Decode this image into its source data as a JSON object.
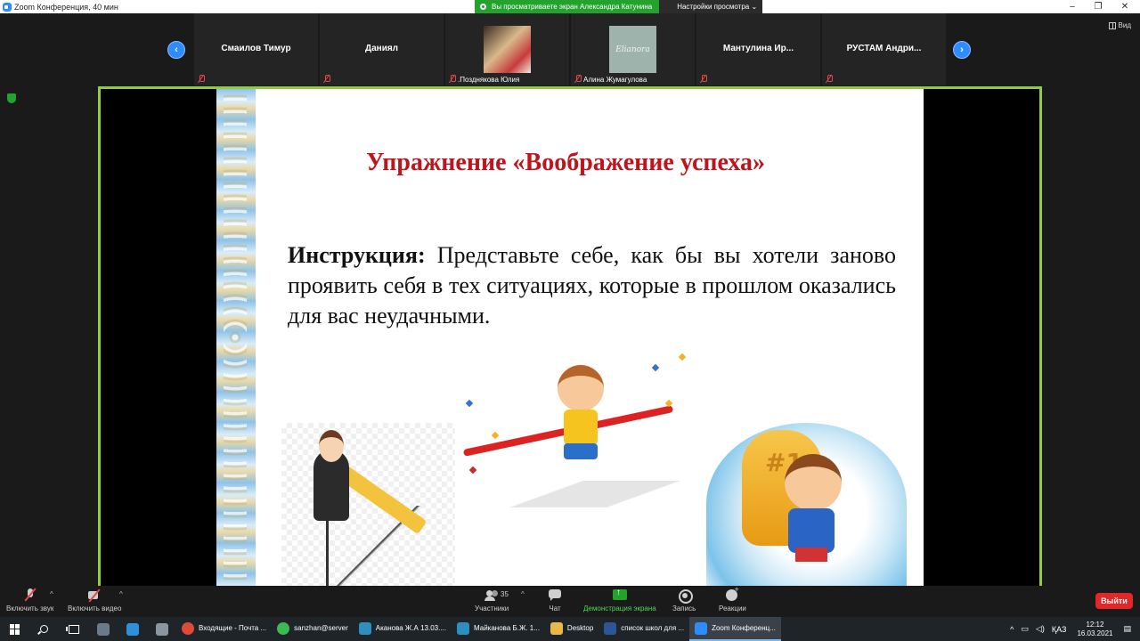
{
  "window": {
    "title": "Zoom Конференция, 40 мин",
    "minimize": "–",
    "restore": "❐",
    "close": "✕"
  },
  "share_banner": {
    "status": "Вы просматриваете экран Александра Катунина",
    "options": "Настройки просмотра ⌄"
  },
  "view_button": {
    "label": "Вид"
  },
  "participants": [
    {
      "name": "Смаилов Тимур",
      "muted": true
    },
    {
      "name": "Даниял",
      "muted": true
    },
    {
      "name": ".Позднякова Юлия",
      "muted": true,
      "has_photo": true
    },
    {
      "name": "Алина Жумагулова",
      "muted": true,
      "has_photo": true,
      "photo_text": "Elianora"
    },
    {
      "name": "Мантулина  Ир...",
      "muted": true
    },
    {
      "name": "РУСТАМ  Андри...",
      "muted": true
    }
  ],
  "nav": {
    "prev": "‹",
    "next": "›"
  },
  "slide": {
    "title": "Упражнение «Воображение успеха»",
    "instruction_label": "Инструкция:",
    "instruction_text": " Представьте себе, как бы вы хотели заново проявить себя в тех ситуациях, которые в прошлом оказались для вас неудачными.",
    "trophy_text": "#1"
  },
  "toolbar": {
    "audio": "Включить звук",
    "video": "Включить видео",
    "participants": "Участники",
    "participants_count": "35",
    "chat": "Чат",
    "share": "Демонстрация экрана",
    "record": "Запись",
    "reactions": "Реакции",
    "leave": "Выйти",
    "caret": "^"
  },
  "taskbar": {
    "apps": [
      {
        "label": "Входящие - Почта ...",
        "color": "#dd4b39"
      },
      {
        "label": "sanzhan@server",
        "color": "#3cba54"
      },
      {
        "label": "Аканова Ж.А 13.03....",
        "color": "#2b8fbf"
      },
      {
        "label": "Майканова Б.Ж. 1...",
        "color": "#2b8fbf"
      },
      {
        "label": "Desktop",
        "color": "#e8b84a"
      },
      {
        "label": "список школ для ...",
        "color": "#2b5797"
      },
      {
        "label": "Zoom Конференц...",
        "color": "#2d8cff"
      }
    ],
    "tray": {
      "up": "^",
      "lang": "ҚАЗ",
      "time": "12:12",
      "date": "16.03.2021"
    }
  }
}
